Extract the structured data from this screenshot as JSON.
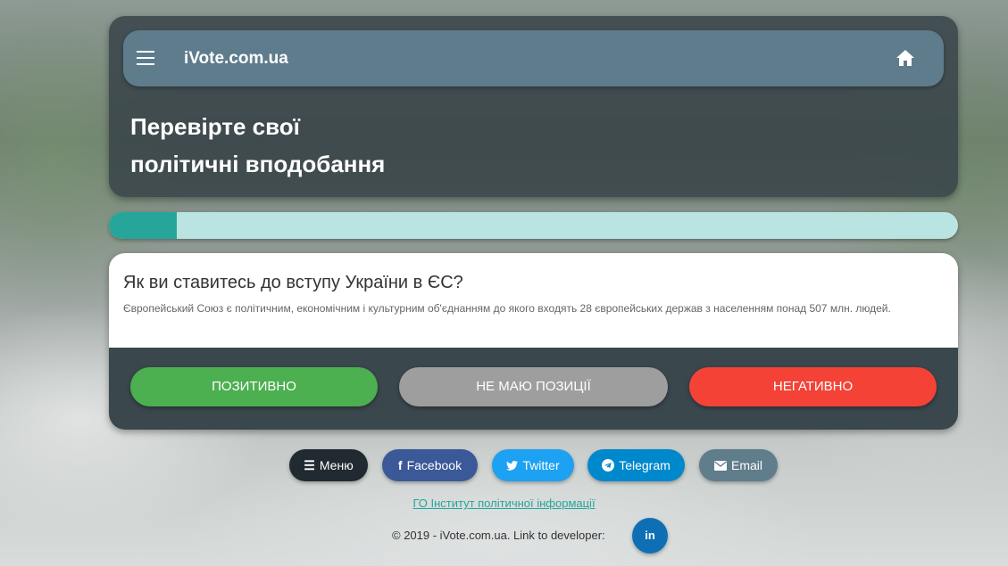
{
  "header": {
    "brand": "iVote.com.ua",
    "headline_line1": "Перевірте свої",
    "headline_line2": "політичні вподобання"
  },
  "progress": {
    "fraction": 0.08
  },
  "question": {
    "title": "Як ви ставитесь до вступу України в ЄС?",
    "description": "Європейський Союз є політичним, економічним і культурним об'єднанням до якого входять 28 європейських держав з населенням понад 507 млн. людей."
  },
  "answers": {
    "positive": "Позитивно",
    "neutral": "Не маю позиції",
    "negative": "Негативно"
  },
  "social": {
    "menu": "Меню",
    "facebook": "Facebook",
    "twitter": "Twitter",
    "telegram": "Telegram",
    "email": "Email"
  },
  "footer": {
    "org_link": "ГО Інститут політичної інформації",
    "copyright": "© 2019 - iVote.com.ua. Link to developer:",
    "linkedin": "in"
  },
  "colors": {
    "navbar": "#5e7c8c",
    "progress_fill": "#26a69a",
    "positive": "#4caf50",
    "neutral": "#9e9e9e",
    "negative": "#f44336"
  },
  "icons": [
    "menu-icon",
    "home-icon",
    "bars-icon",
    "facebook-icon",
    "twitter-icon",
    "telegram-icon",
    "envelope-icon",
    "linkedin-icon"
  ]
}
